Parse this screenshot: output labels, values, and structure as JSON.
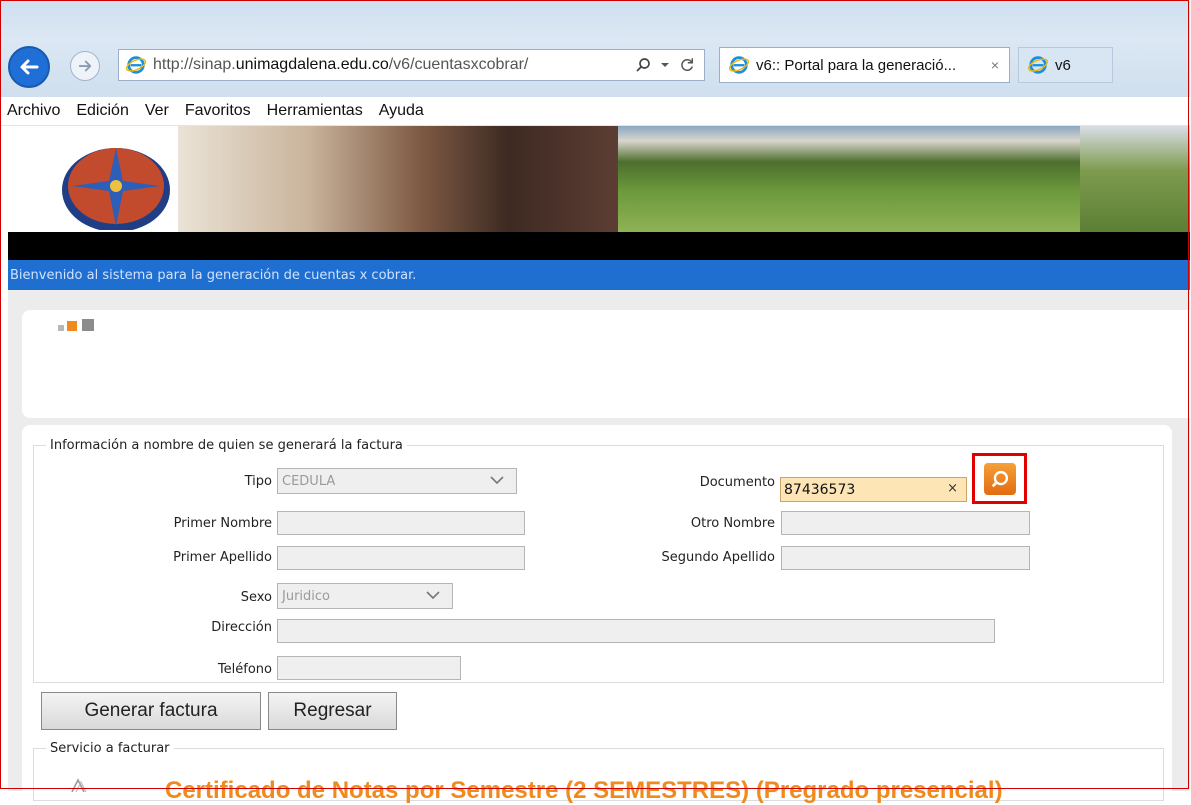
{
  "browser": {
    "url_prefix": "http://sinap.",
    "url_host": "unimagdalena.edu.co",
    "url_path": "/v6/cuentasxcobrar/",
    "tabs": [
      {
        "title": "v6:: Portal para la generació...",
        "close": "×"
      },
      {
        "title": "v6"
      }
    ],
    "menu": [
      "Archivo",
      "Edición",
      "Ver",
      "Favoritos",
      "Herramientas",
      "Ayuda"
    ],
    "icons": {
      "back": "back-arrow-icon",
      "forward": "forward-arrow-icon",
      "search": "search-icon",
      "refresh": "refresh-icon"
    }
  },
  "site": {
    "welcome": "Bienvenido al sistema para la generación de cuentas x cobrar.",
    "colors": {
      "blue_bar": "#1e6fd0",
      "accent_orange": "#f08a1c",
      "highlight_red": "#e00000",
      "doc_field": "#fde5b6"
    }
  },
  "form": {
    "legend": "Información a nombre de quien se generará la factura",
    "tipo_label": "Tipo",
    "tipo_value": "CEDULA",
    "documento_label": "Documento",
    "documento_value": "87436573",
    "clear_mark": "×",
    "primer_nombre_label": "Primer Nombre",
    "otro_nombre_label": "Otro Nombre",
    "primer_apellido_label": "Primer Apellido",
    "segundo_apellido_label": "Segundo Apellido",
    "sexo_label": "Sexo",
    "sexo_value": "Juridico",
    "direccion_label": "Dirección",
    "telefono_label": "Teléfono",
    "generar_label": "Generar factura",
    "regresar_label": "Regresar"
  },
  "service": {
    "legend": "Servicio a facturar",
    "title": "Certificado de Notas por Semestre (2 SEMESTRES) (Pregrado presencial)"
  }
}
